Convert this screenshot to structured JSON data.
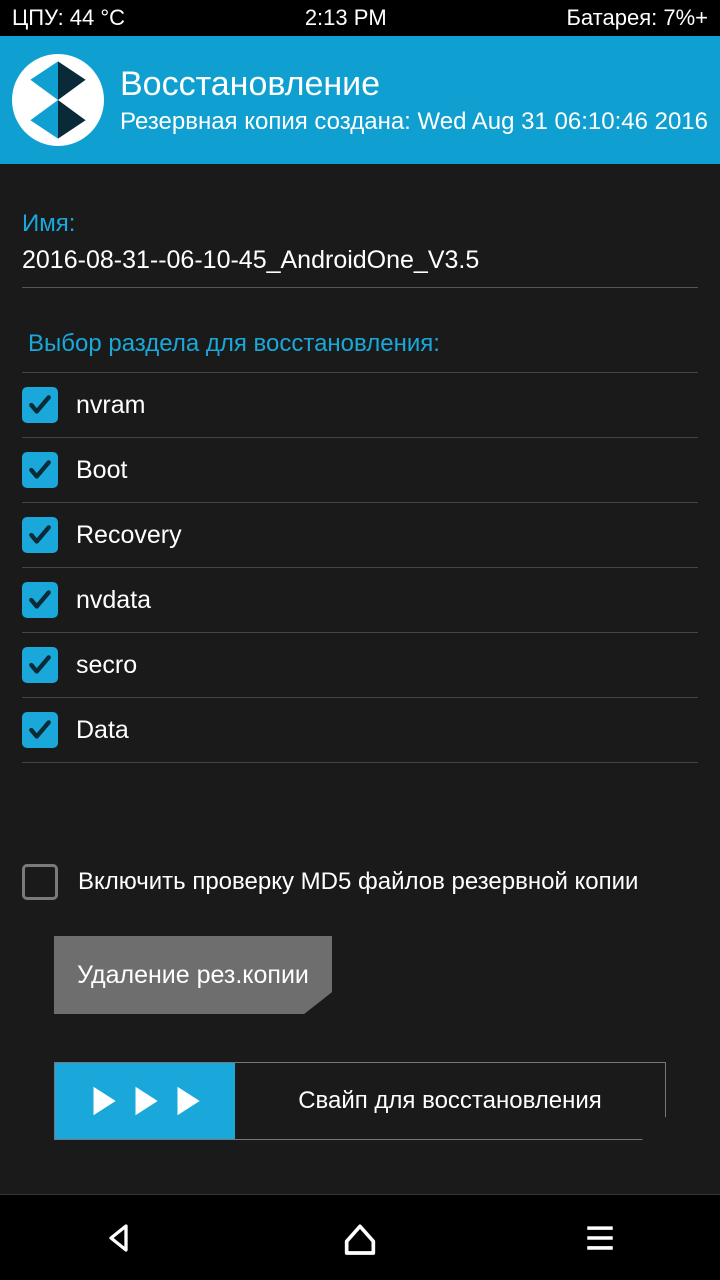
{
  "status": {
    "cpu": "ЦПУ: 44 °C",
    "time": "2:13 PM",
    "battery": "Батарея: 7%+"
  },
  "header": {
    "title": "Восстановление",
    "subtitle": "Резервная копия создана: Wed Aug 31 06:10:46 2016"
  },
  "name_field": {
    "label": "Имя:",
    "value": "2016-08-31--06-10-45_AndroidOne_V3.5"
  },
  "partition_section": {
    "label": "Выбор раздела для восстановления:",
    "items": [
      {
        "label": "nvram",
        "checked": true
      },
      {
        "label": "Boot",
        "checked": true
      },
      {
        "label": "Recovery",
        "checked": true
      },
      {
        "label": "nvdata",
        "checked": true
      },
      {
        "label": "secro",
        "checked": true
      },
      {
        "label": "Data",
        "checked": true
      }
    ]
  },
  "md5": {
    "label": "Включить проверку MD5 файлов резервной копии",
    "checked": false
  },
  "delete_button": {
    "label": "Удаление рез.копии"
  },
  "swipe": {
    "label": "Свайп для восстановления"
  }
}
